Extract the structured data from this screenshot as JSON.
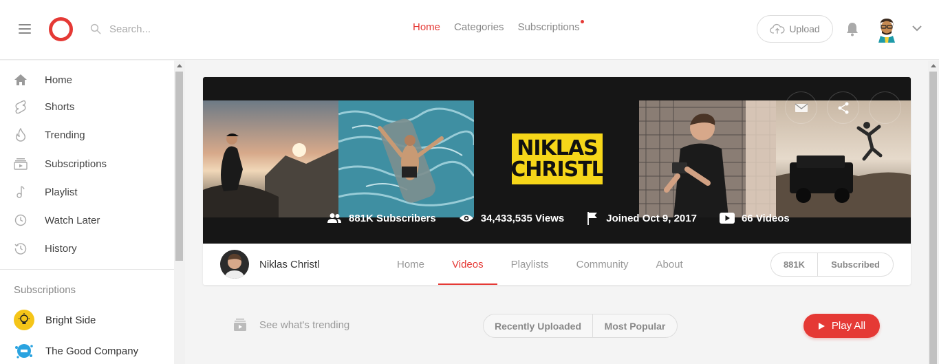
{
  "header": {
    "search_placeholder": "Search...",
    "nav": [
      {
        "label": "Home",
        "active": true
      },
      {
        "label": "Categories",
        "active": false
      },
      {
        "label": "Subscriptions",
        "active": false,
        "has_notification_dot": true
      }
    ],
    "upload_label": "Upload",
    "icons": [
      "menu-icon",
      "logo-icon",
      "search-icon",
      "cloud-upload-icon",
      "bell-icon",
      "avatar",
      "chevron-down-icon"
    ]
  },
  "sidebar": {
    "items": [
      {
        "label": "Home",
        "icon": "home-icon"
      },
      {
        "label": "Shorts",
        "icon": "shorts-icon"
      },
      {
        "label": "Trending",
        "icon": "flame-icon"
      },
      {
        "label": "Subscriptions",
        "icon": "subscriptions-icon"
      },
      {
        "label": "Playlist",
        "icon": "music-note-icon"
      },
      {
        "label": "Watch Later",
        "icon": "clock-icon"
      },
      {
        "label": "History",
        "icon": "history-icon"
      }
    ],
    "subscriptions_heading": "Subscriptions",
    "subscriptions": [
      {
        "label": "Bright Side",
        "avatar_color": "#f5c518"
      },
      {
        "label": "The Good Company",
        "avatar_color": "#2aa3e0"
      }
    ]
  },
  "channel": {
    "banner_logo_line1": "NIKLAS",
    "banner_logo_line2": "CHRISTL",
    "stats": {
      "subscribers": "881K Subscribers",
      "views": "34,433,535 Views",
      "joined": "Joined Oct 9, 2017",
      "videos": "66 Videos"
    },
    "name": "Niklas Christl",
    "tabs": [
      {
        "label": "Home",
        "active": false
      },
      {
        "label": "Videos",
        "active": true
      },
      {
        "label": "Playlists",
        "active": false
      },
      {
        "label": "Community",
        "active": false
      },
      {
        "label": "About",
        "active": false
      }
    ],
    "subscriber_count": "881K",
    "subscribe_label": "Subscribed"
  },
  "filters": {
    "trending_label": "See what's trending",
    "recently_uploaded": "Recently Uploaded",
    "most_popular": "Most Popular",
    "play_all": "Play All"
  },
  "colors": {
    "accent": "#e53935",
    "logo_yellow": "#f6d619",
    "banner_bg": "#161616"
  }
}
